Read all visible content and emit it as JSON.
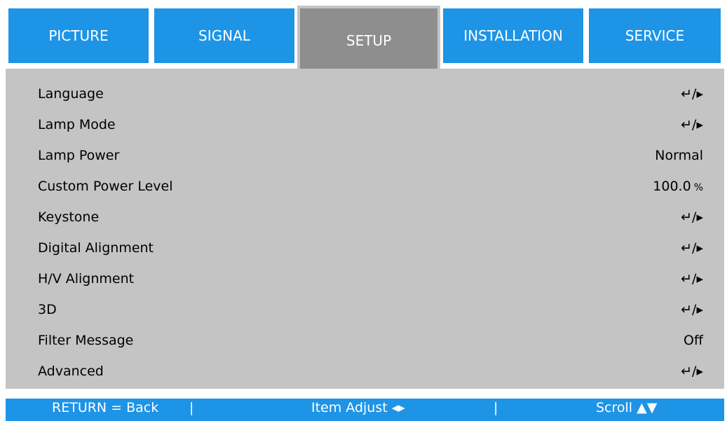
{
  "tabs": [
    {
      "label": "PICTURE",
      "active": false
    },
    {
      "label": "SIGNAL",
      "active": false
    },
    {
      "label": "SETUP",
      "active": true
    },
    {
      "label": "INSTALLATION",
      "active": false
    },
    {
      "label": "SERVICE",
      "active": false
    }
  ],
  "menu": {
    "items": [
      {
        "label": "Language",
        "value": "↵/▸"
      },
      {
        "label": "Lamp Mode",
        "value": "↵/▸"
      },
      {
        "label": "Lamp Power",
        "value": "Normal"
      },
      {
        "label": "Custom Power Level",
        "value": "100.0",
        "unit": "%"
      },
      {
        "label": "Keystone",
        "value": "↵/▸"
      },
      {
        "label": "Digital Alignment",
        "value": "↵/▸"
      },
      {
        "label": "H/V Alignment",
        "value": "↵/▸"
      },
      {
        "label": "3D",
        "value": "↵/▸"
      },
      {
        "label": "Filter Message",
        "value": "Off"
      },
      {
        "label": "Advanced",
        "value": "↵/▸"
      }
    ]
  },
  "footer": {
    "return_hint": "RETURN = Back",
    "separator": "|",
    "adjust_hint": "Item Adjust ◂▸",
    "scroll_hint": "Scroll ▲▼"
  },
  "colors": {
    "tab_blue": "#1e94e6",
    "tab_active": "#8e8e8e",
    "panel_gray": "#c4c4c4"
  }
}
